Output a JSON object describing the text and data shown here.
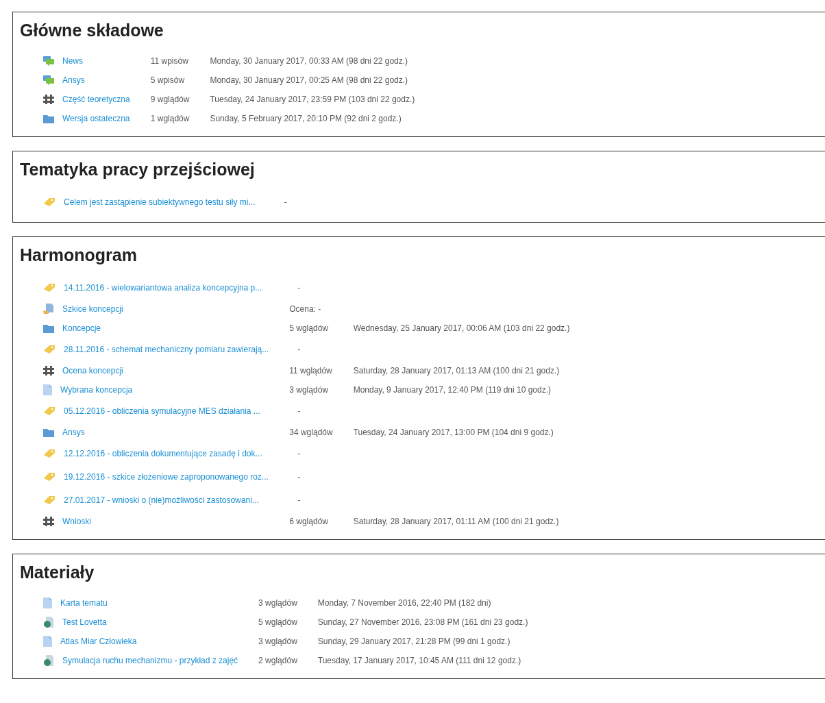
{
  "sections": [
    {
      "title": "Główne składowe",
      "activities": [
        {
          "kind": "forum",
          "name": "News",
          "count": "11 wpisów",
          "date": "Monday, 30 January 2017, 00:33 AM (98 dni 22 godz.)"
        },
        {
          "kind": "forum",
          "name": "Ansys",
          "count": "5 wpisów",
          "date": "Monday, 30 January 2017, 00:25 AM (98 dni 22 godz.)"
        },
        {
          "kind": "workshop",
          "name": "Część teoretyczna",
          "count": "9 wglądów",
          "date": "Tuesday, 24 January 2017, 23:59 PM (103 dni 22 godz.)"
        },
        {
          "kind": "folder",
          "name": "Wersja ostateczna",
          "count": "1 wglądów",
          "date": "Sunday, 5 February 2017, 20:10 PM (92 dni 2 godz.)"
        }
      ]
    },
    {
      "title": "Tematyka pracy przejściowej",
      "activities": [
        {
          "kind": "label",
          "name": "Celem jest zastąpienie subiektywnego testu siły mi...",
          "count": "-"
        }
      ]
    },
    {
      "title": "Harmonogram",
      "activities": [
        {
          "kind": "label",
          "name": "14.11.2016 - wielowariantowa analiza koncepcyjna p...",
          "count": "-"
        },
        {
          "kind": "assignment",
          "name": "Szkice koncepcji",
          "count": "Ocena: -"
        },
        {
          "kind": "folder",
          "name": "Koncepcje",
          "count": "5 wglądów",
          "date": "Wednesday, 25 January 2017, 00:06 AM (103 dni 22 godz.)"
        },
        {
          "kind": "label",
          "name": "28.11.2016 - schemat mechaniczny pomiaru zawierają...",
          "count": "-"
        },
        {
          "kind": "workshop",
          "name": "Ocena koncepcji",
          "count": "11 wglądów",
          "date": "Saturday, 28 January 2017, 01:13 AM (100 dni 21 godz.)"
        },
        {
          "kind": "page",
          "name": "Wybrana koncepcja",
          "count": "3 wglądów",
          "date": "Monday, 9 January 2017, 12:40 PM (119 dni 10 godz.)"
        },
        {
          "kind": "label",
          "name": "05.12.2016 - obliczenia symulacyjne MES działania ...",
          "count": "-"
        },
        {
          "kind": "folder",
          "name": "Ansys",
          "count": "34 wglądów",
          "date": "Tuesday, 24 January 2017, 13:00 PM (104 dni 9 godz.)"
        },
        {
          "kind": "label",
          "name": "12.12.2016 - obliczenia dokumentujące zasadę i dok...",
          "count": "-"
        },
        {
          "kind": "label",
          "name": "19.12.2016 - szkice złożeniowe zaproponowanego roz...",
          "count": "-"
        },
        {
          "kind": "label",
          "name": "27.01.2017 - wnioski o (nie)możliwości zastosowani...",
          "count": "-"
        },
        {
          "kind": "workshop",
          "name": "Wnioski",
          "count": "6 wglądów",
          "date": "Saturday, 28 January 2017, 01:11 AM (100 dni 21 godz.)"
        }
      ]
    },
    {
      "title": "Materiały",
      "activities": [
        {
          "kind": "page",
          "name": "Karta tematu",
          "count": "3 wglądów",
          "date": "Monday, 7 November 2016, 22:40 PM (182 dni)"
        },
        {
          "kind": "resource",
          "name": "Test Lovetta",
          "count": "5 wglądów",
          "date": "Sunday, 27 November 2016, 23:08 PM (161 dni 23 godz.)"
        },
        {
          "kind": "page",
          "name": "Atlas Miar Człowieka",
          "count": "3 wglądów",
          "date": "Sunday, 29 January 2017, 21:28 PM (99 dni 1 godz.)"
        },
        {
          "kind": "resource",
          "name": "Symulacja ruchu mechanizmu - przykład z zajęć",
          "count": "2 wglądów",
          "date": "Tuesday, 17 January 2017, 10:45 AM (111 dni 12 godz.)"
        }
      ]
    }
  ]
}
